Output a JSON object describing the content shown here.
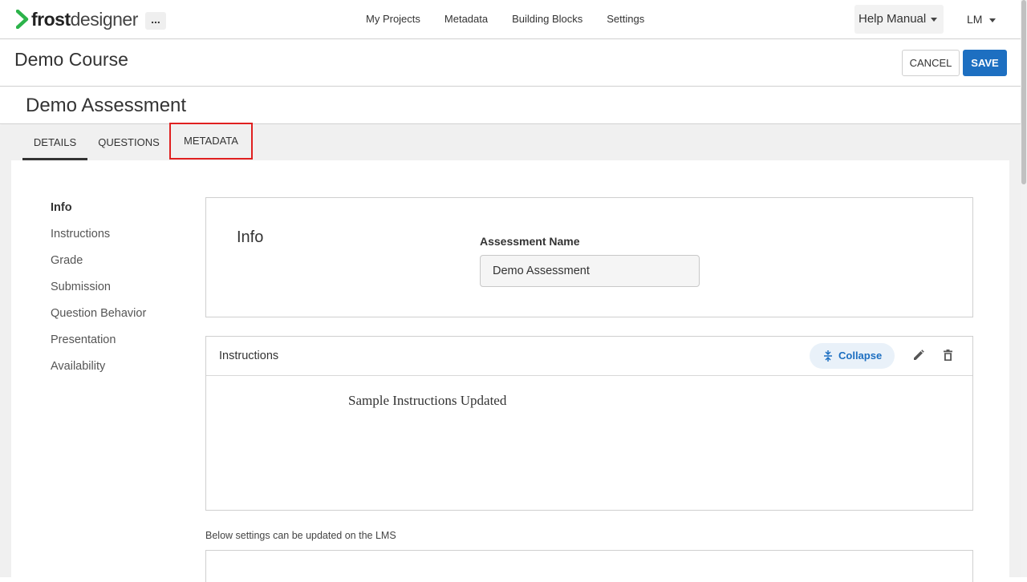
{
  "header": {
    "logo": {
      "bold": "frost",
      "light": "designer"
    },
    "more_label": "...",
    "nav": [
      "My Projects",
      "Metadata",
      "Building Blocks",
      "Settings"
    ],
    "help_label": "Help Manual",
    "user_initials": "LM"
  },
  "course": {
    "title": "Demo Course",
    "cancel_label": "CANCEL",
    "save_label": "SAVE"
  },
  "assessment": {
    "title": "Demo Assessment",
    "tabs": [
      "DETAILS",
      "QUESTIONS",
      "METADATA"
    ],
    "active_tab": "DETAILS",
    "highlighted_tab": "METADATA"
  },
  "sidebar": {
    "items": [
      "Info",
      "Instructions",
      "Grade",
      "Submission",
      "Question Behavior",
      "Presentation",
      "Availability"
    ],
    "active": "Info"
  },
  "info_card": {
    "heading": "Info",
    "field_label": "Assessment Name",
    "field_value": "Demo Assessment"
  },
  "instructions_card": {
    "title": "Instructions",
    "collapse_label": "Collapse",
    "body": "Sample Instructions Updated"
  },
  "lms_note": "Below settings can be updated on the LMS",
  "colors": {
    "brand_green": "#2cb34a",
    "primary_blue": "#1d6fc1",
    "highlight_red": "#e02020"
  }
}
